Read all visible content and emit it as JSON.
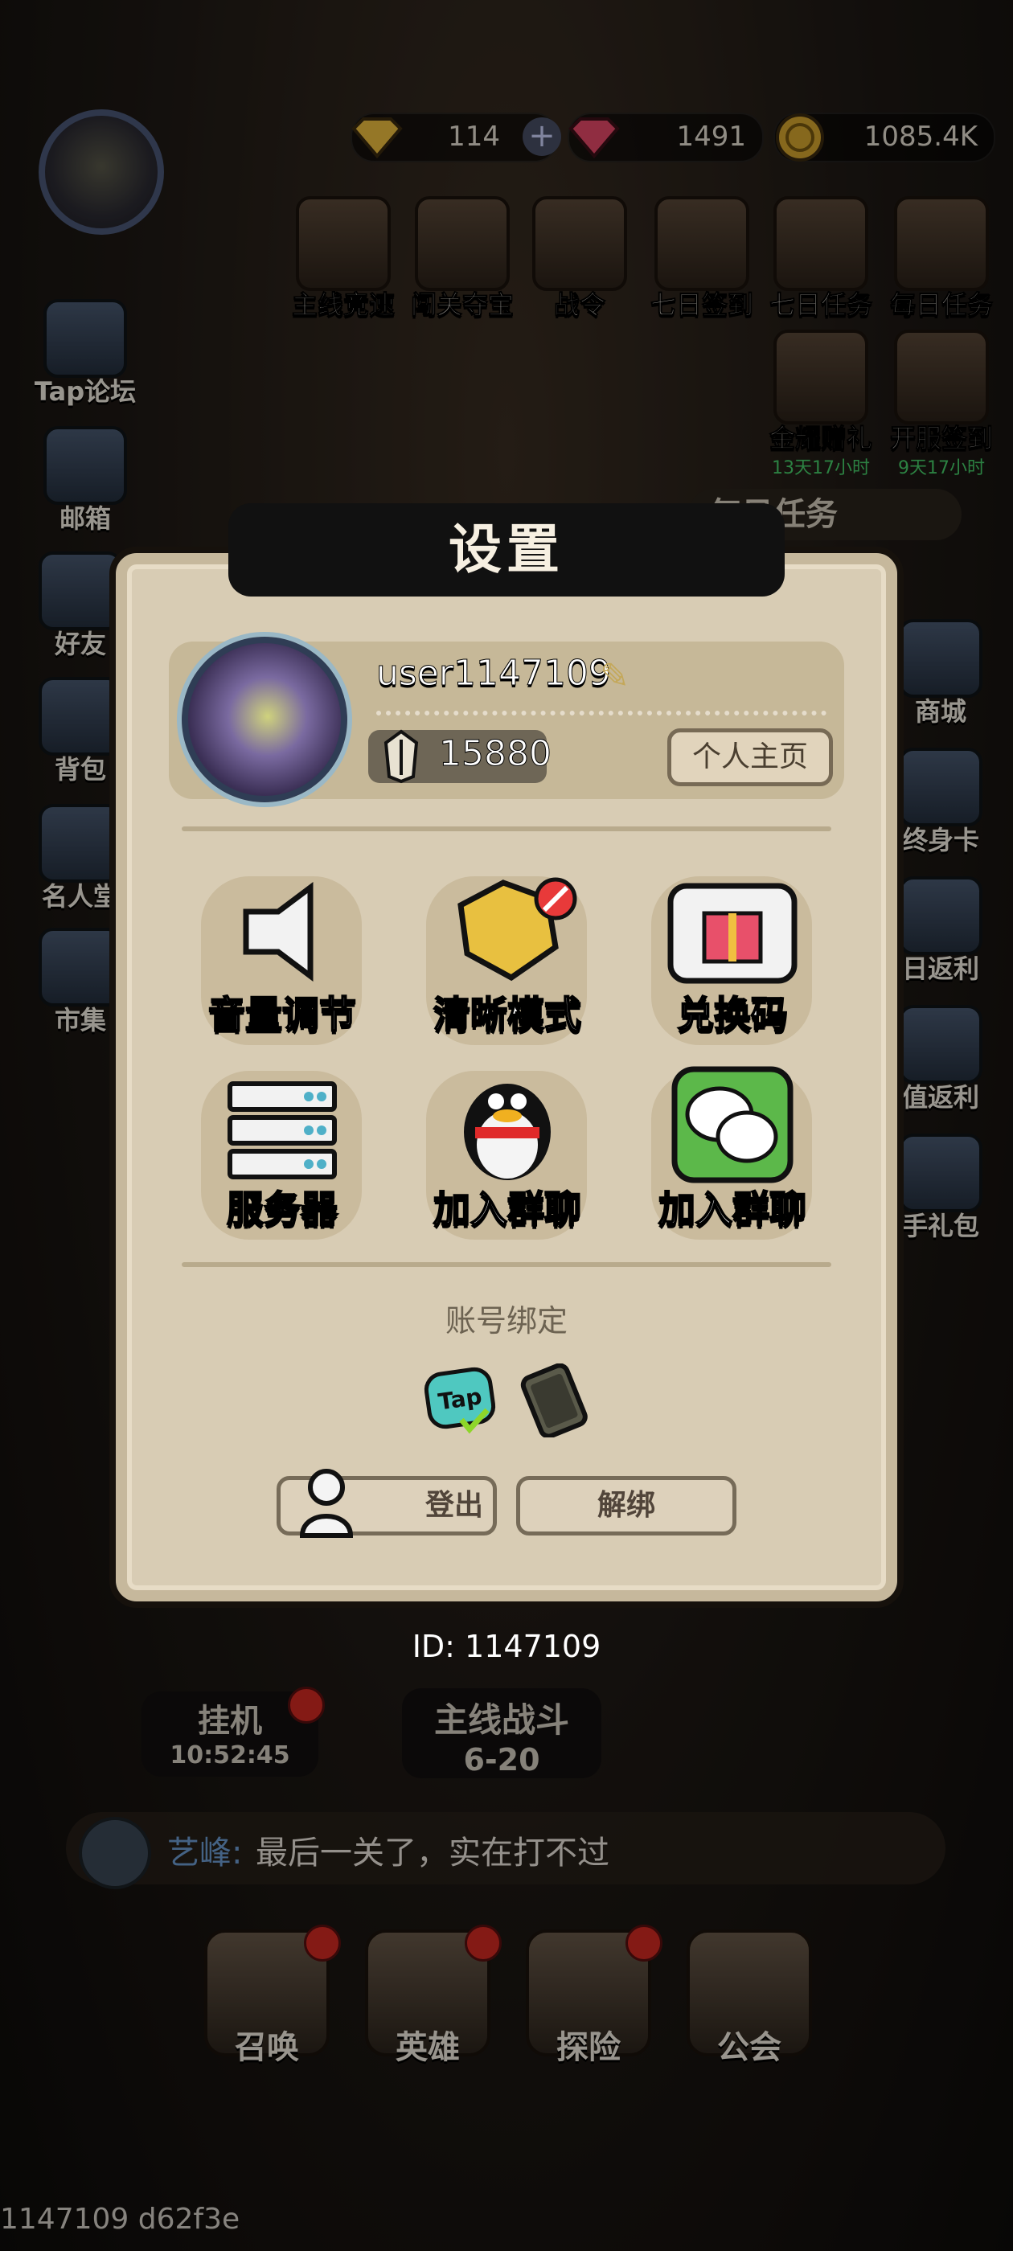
{
  "currency": {
    "diamond": "114",
    "ruby": "1491",
    "coins": "1085.4K"
  },
  "top_icons": [
    {
      "label": "主线竞速",
      "sub": ""
    },
    {
      "label": "闯关夺宝",
      "sub": ""
    },
    {
      "label": "战令",
      "sub": ""
    },
    {
      "label": "七日签到",
      "sub": ""
    },
    {
      "label": "七日任务",
      "sub": ""
    },
    {
      "label": "每日任务",
      "sub": ""
    },
    {
      "label": "金耀赠礼",
      "sub": "13天17小时"
    },
    {
      "label": "开服签到",
      "sub": "9天17小时"
    }
  ],
  "left_sidebar": [
    "Tap论坛",
    "邮箱",
    "好友",
    "背包",
    "名人堂",
    "市集"
  ],
  "right_sidebar": [
    "商城",
    "终身卡",
    "日返利",
    "值返利",
    "手礼包"
  ],
  "right_banner": "每日任务",
  "settings": {
    "title": "设置",
    "username": "user1147109",
    "power": "15880",
    "profile_button": "个人主页",
    "options": [
      {
        "label": "音量调节",
        "icon": "speaker-icon"
      },
      {
        "label": "清晰模式",
        "icon": "clarity-icon"
      },
      {
        "label": "兑换码",
        "icon": "gift-icon"
      },
      {
        "label": "服务器",
        "icon": "server-icon"
      },
      {
        "label": "加入群聊",
        "icon": "qq-penguin-icon"
      },
      {
        "label": "加入群聊",
        "icon": "wechat-icon"
      }
    ],
    "account_binding_label": "账号绑定",
    "logout_label": "登出",
    "unbind_label": "解绑",
    "player_id": "ID: 1147109"
  },
  "idle": {
    "label": "挂机",
    "timer": "10:52:45"
  },
  "main_battle": {
    "label": "主线战斗",
    "stage": "6-20"
  },
  "chat": {
    "name": "艺峰:",
    "message": "最后一关了，实在打不过"
  },
  "bottom_nav": [
    "召唤",
    "英雄",
    "探险",
    "公会"
  ],
  "footer_id": "1147109 d62f3e",
  "colors": {
    "panel": "#d8ccb4",
    "accent_green": "#47d06b",
    "chat_name": "#6f9fd6",
    "badge_red": "#d62a22"
  }
}
